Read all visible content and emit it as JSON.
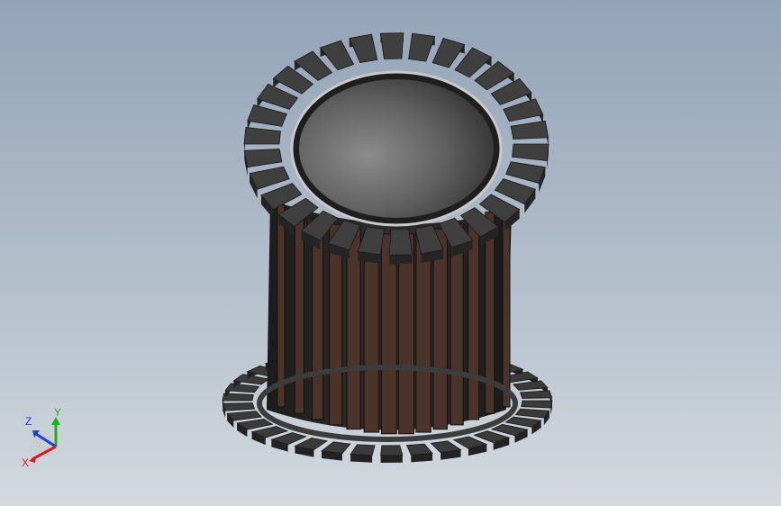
{
  "viewport": {
    "background_top": "#93a4b7",
    "background_bottom": "#d4d9df"
  },
  "model": {
    "part": "stator-core",
    "winding_color": "#4a3328",
    "core_color": "#2e2e2e",
    "bore_color": "#5a5a5a"
  },
  "triad": {
    "x_label": "X",
    "y_label": "Y",
    "z_label": "Z",
    "x_color": "#d42020",
    "y_color": "#1fae1f",
    "z_color": "#1e3fd6"
  }
}
